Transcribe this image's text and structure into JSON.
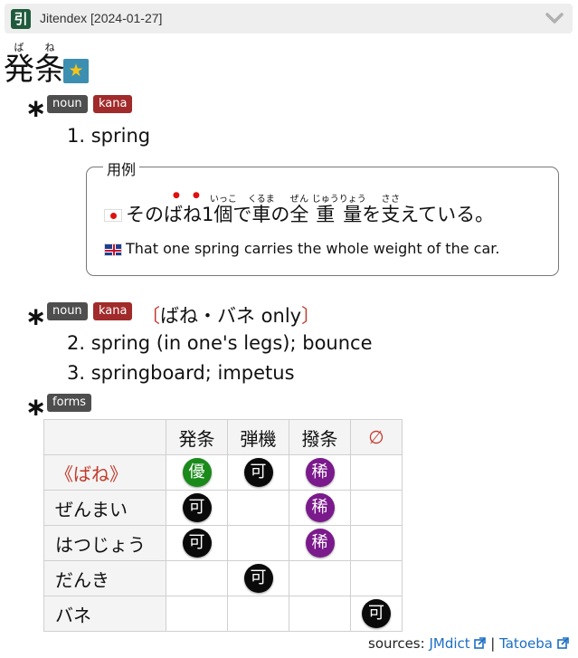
{
  "header": {
    "icon_glyph": "引",
    "title": "Jitendex [2024-01-27]"
  },
  "headword": {
    "chars": [
      {
        "kanji": "発",
        "reading": "ば"
      },
      {
        "kanji": "条",
        "reading": "ね"
      }
    ],
    "star_glyph": "★"
  },
  "senses": [
    {
      "tags": [
        "noun",
        "kana"
      ],
      "glosses": [
        {
          "num": "1.",
          "text": "spring"
        }
      ]
    },
    {
      "tags": [
        "noun",
        "kana"
      ],
      "restriction_open": "〔",
      "restriction_text": "ばね・バネ only",
      "restriction_close": "〕",
      "glosses": [
        {
          "num": "2.",
          "text": "spring (in one's legs); bounce"
        },
        {
          "num": "3.",
          "text": "springboard; impetus"
        }
      ]
    }
  ],
  "example": {
    "legend": "用例",
    "jp_parts": {
      "p1": "そのばね",
      "num": "1",
      "ko": "個",
      "ko_rt": "いっこ",
      "de": "で",
      "kuruma": "車",
      "kuruma_rt": "くるま",
      "no": "の",
      "zen": "全",
      "zen_rt": "ぜん",
      "ju": "重",
      "ju_rt": "じゅう",
      "ryo": "量",
      "ryo_rt": "りょう",
      "wo": "を",
      "sasa": "支",
      "sasa_rt": "ささ",
      "tail": "えている。"
    },
    "en": "That one spring carries the whole weight of the car."
  },
  "forms_tag": "forms",
  "forms": {
    "columns": [
      "発条",
      "弾機",
      "撥条",
      "∅"
    ],
    "rows": [
      {
        "label": "《ばね》",
        "cells": [
          "優",
          "可",
          "稀",
          ""
        ]
      },
      {
        "label": "ぜんまい",
        "cells": [
          "可",
          "",
          "稀",
          ""
        ]
      },
      {
        "label": "はつじょう",
        "cells": [
          "可",
          "",
          "稀",
          ""
        ]
      },
      {
        "label": "だんき",
        "cells": [
          "",
          "可",
          "",
          ""
        ]
      },
      {
        "label": "バネ",
        "cells": [
          "",
          "",
          "",
          "可"
        ]
      }
    ]
  },
  "sources": {
    "label": "sources:",
    "link1": "JMdict",
    "sep": "|",
    "link2": "Tatoeba"
  },
  "colors": {
    "green": "#1a8a1a",
    "black": "#0a0a0a",
    "purple": "#7b1a8c",
    "accent_red": "#c23a2b",
    "link": "#1a6ec4"
  }
}
